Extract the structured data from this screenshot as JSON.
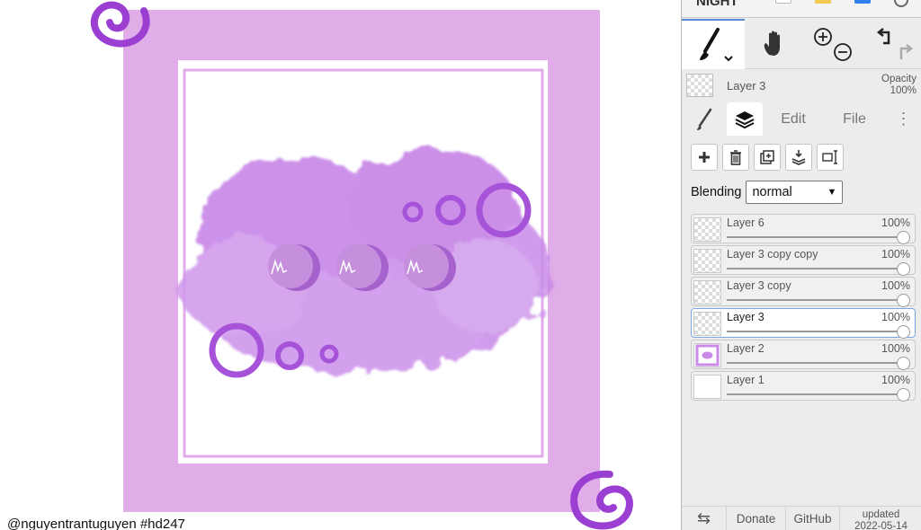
{
  "canvas": {
    "credit": "@nguyentrantuguyen #hd247",
    "colors": {
      "frame": "#e0ade9",
      "ink": "#9b3fd2",
      "splash": "#bf7ae8",
      "button": "#c58fde",
      "button_shadow": "#a561cc"
    }
  },
  "panel": {
    "top_strip_label": "NIGHT",
    "tools": {
      "brush_icon": "brush-icon",
      "hand_icon": "hand-icon",
      "zoom_icons": "zoom-in-out-icon",
      "undo_icons": "undo-redo-icon"
    },
    "current_layer": {
      "name": "Layer 3",
      "opacity_label": "Opacity",
      "opacity_value": "100%"
    },
    "tabs": {
      "brush_icon": "brush-tab-icon",
      "layers_icon": "layers-tab-icon",
      "edit": "Edit",
      "file": "File",
      "more": "⋮"
    },
    "layer_toolbar": [
      "add-layer-icon",
      "delete-layer-icon",
      "duplicate-layer-icon",
      "merge-down-icon",
      "transform-icon"
    ],
    "blending": {
      "label": "Blending",
      "value": "normal"
    },
    "layers": [
      {
        "name": "Layer 6",
        "opacity": "100%"
      },
      {
        "name": "Layer 3 copy copy",
        "opacity": "100%"
      },
      {
        "name": "Layer 3 copy",
        "opacity": "100%"
      },
      {
        "name": "Layer 3",
        "opacity": "100%",
        "selected": true
      },
      {
        "name": "Layer 2",
        "opacity": "100%"
      },
      {
        "name": "Layer 1",
        "opacity": "100%"
      }
    ],
    "footer": {
      "swap": "⇆",
      "donate": "Donate",
      "github": "GitHub",
      "updated_label": "updated",
      "updated_date": "2022-05-14"
    },
    "accent": "#5a8cd8"
  }
}
